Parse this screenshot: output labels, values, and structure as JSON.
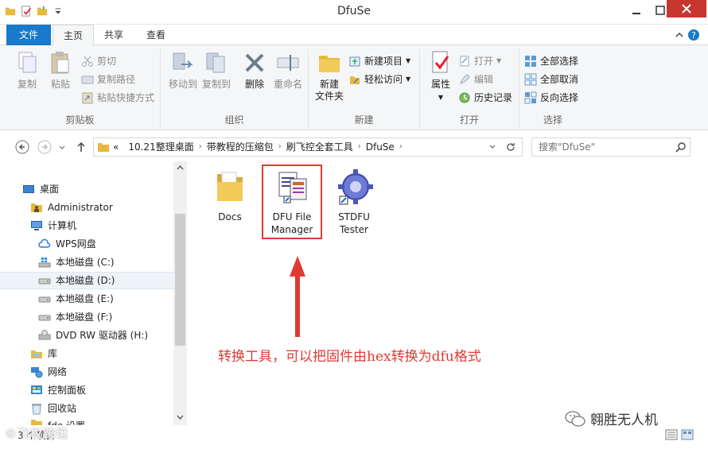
{
  "window": {
    "title": "DfuSe"
  },
  "tabs": {
    "file": "文件",
    "home": "主页",
    "share": "共享",
    "view": "查看"
  },
  "ribbon": {
    "clipboard": {
      "title": "剪贴板",
      "copy": "复制",
      "paste": "粘贴",
      "cut": "剪切",
      "copy_path": "复制路径",
      "paste_shortcut": "粘贴快捷方式"
    },
    "organize": {
      "title": "组织",
      "move_to": "移动到",
      "copy_to": "复制到",
      "delete": "删除",
      "rename": "重命名"
    },
    "new": {
      "title": "新建",
      "new_folder_l1": "新建",
      "new_folder_l2": "文件夹",
      "new_item": "新建项目",
      "easy_access": "轻松访问"
    },
    "open": {
      "title": "打开",
      "properties": "属性",
      "open": "打开",
      "edit": "编辑",
      "history": "历史记录"
    },
    "select": {
      "title": "选择",
      "select_all": "全部选择",
      "select_none": "全部取消",
      "invert": "反向选择"
    }
  },
  "address": {
    "prefix": "«",
    "crumbs": [
      "10.21整理桌面",
      "带教程的压缩包",
      "刷飞控全套工具",
      "DfuSe"
    ]
  },
  "search": {
    "placeholder": "搜索\"DfuSe\""
  },
  "nav": {
    "items": [
      {
        "label": "桌面"
      },
      {
        "label": "Administrator"
      },
      {
        "label": "计算机"
      },
      {
        "label": "WPS网盘"
      },
      {
        "label": "本地磁盘 (C:)"
      },
      {
        "label": "本地磁盘 (D:)"
      },
      {
        "label": "本地磁盘 (E:)"
      },
      {
        "label": "本地磁盘 (F:)"
      },
      {
        "label": "DVD RW 驱动器 (H:)"
      },
      {
        "label": "库"
      },
      {
        "label": "网络"
      },
      {
        "label": "控制面板"
      },
      {
        "label": "回收站"
      },
      {
        "label": "fde 设置"
      }
    ]
  },
  "files": [
    {
      "line1": "Docs",
      "line2": ""
    },
    {
      "line1": "DFU File",
      "line2": "Manager"
    },
    {
      "line1": "STDFU",
      "line2": "Tester"
    }
  ],
  "annotation": "转换工具，可以把固件由hex转换为dfu格式",
  "status": {
    "count": "3 个项目"
  },
  "watermark": {
    "left": "©飞权跨境",
    "right": "翱胜无人机"
  },
  "colors": {
    "accent": "#1979ca",
    "highlight": "#e03a33",
    "close": "#c7362f"
  }
}
